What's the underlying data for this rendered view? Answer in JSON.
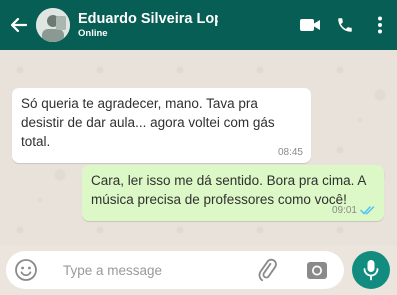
{
  "header": {
    "contact_name": "Eduardo Silveira Lop",
    "status": "Online",
    "icons": [
      "back-arrow-icon",
      "video-call-icon",
      "phone-icon",
      "more-vert-icon"
    ]
  },
  "messages": [
    {
      "direction": "incoming",
      "text": "Só queria te agradecer, mano. Tava pra desistir de dar aula... agora voltei com gás total.",
      "time": "08:45"
    },
    {
      "direction": "outgoing",
      "text": "Cara, ler isso me dá sentido. Bora pra cima. A música precisa de professores como você!",
      "time": "09:01",
      "read": true
    }
  ],
  "composer": {
    "placeholder": "Type a message",
    "icons": [
      "emoji-icon",
      "attachment-clip-icon",
      "camera-icon",
      "microphone-icon"
    ]
  },
  "colors": {
    "header": "#075e54",
    "chat_bg": "#ece5dd",
    "incoming_bubble": "#ffffff",
    "outgoing_bubble": "#dcf8c6",
    "mic_button": "#128c7e",
    "read_ticks": "#4fc3f7"
  }
}
